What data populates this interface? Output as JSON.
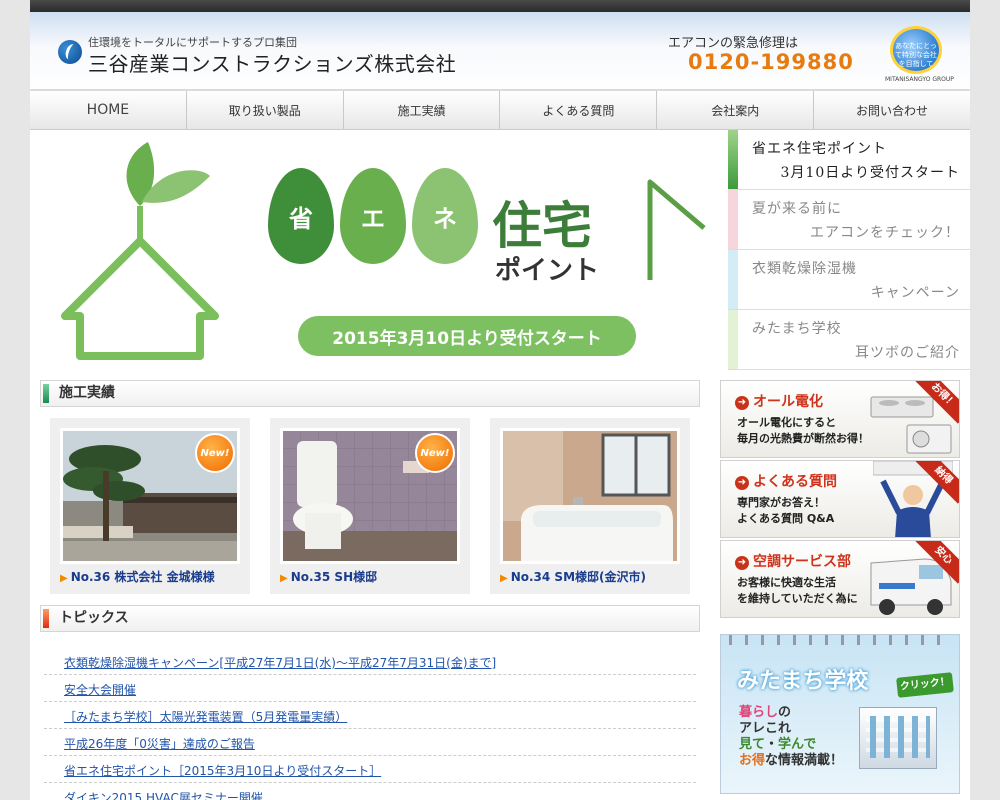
{
  "header": {
    "tagline": "住環境をトータルにサポートするプロ集団",
    "company": "三谷産業コンストラクションズ株式会社",
    "contact_label": "エアコンの緊急修理は",
    "phone": "0120-199880",
    "badge_label": "MITANISANGYO GROUP",
    "badge_text": "あなたにとって特別な会社を目指して"
  },
  "nav": {
    "items": [
      "HOME",
      "取り扱い製品",
      "施工実績",
      "よくある質問",
      "会社案内",
      "お問い合わせ"
    ]
  },
  "hero": {
    "leaves": [
      "省",
      "エ",
      "ネ"
    ],
    "word1": "住宅",
    "word2": "ポイント",
    "pill": "2015年3月10日より受付スタート"
  },
  "slider_tabs": [
    {
      "line1": "省エネ住宅ポイント",
      "line2": "3月10日より受付スタート",
      "color": "#3d9a3d"
    },
    {
      "line1": "夏が来る前に",
      "line2": "エアコンをチェック！",
      "color": "#f6d6dc"
    },
    {
      "line1": "衣類乾燥除湿機",
      "line2": "キャンペーン",
      "color": "#d3ecf6"
    },
    {
      "line1": "みたまち学校",
      "line2": "耳ツボのご紹介",
      "color": "#e3f1d4"
    }
  ],
  "works": {
    "heading": "施工実績",
    "new_label": "New!",
    "items": [
      {
        "caption": "No.36 株式会社 金城様様",
        "is_new": true
      },
      {
        "caption": "No.35 SH様邸",
        "is_new": true
      },
      {
        "caption": "No.34 SM様邸(金沢市)",
        "is_new": false
      }
    ]
  },
  "topics": {
    "heading": "トピックス",
    "items": [
      "衣類乾燥除湿機キャンペーン[平成27年7月1日(水)～平成27年7月31日(金)まで]",
      "安全大会開催",
      "［みたまち学校］太陽光発電装置（5月発電量実績）",
      "平成26年度「0災害」達成のご報告",
      "省エネ住宅ポイント［2015年3月10日より受付スタート］",
      "ダイキン2015 HVAC展セミナー開催"
    ]
  },
  "promos": [
    {
      "title": "オール電化",
      "text1": "オール電化にすると",
      "text2": "毎月の光熱費が断然お得！",
      "ribbon": "お得！"
    },
    {
      "title": "よくある質問",
      "text1": "専門家がお答え！",
      "text2": "よくある質問 Q&A",
      "ribbon": "納得"
    },
    {
      "title": "空調サービス部",
      "text1": "お客様に快適な生活",
      "text2": "を維持していただく為に",
      "ribbon": "安心"
    }
  ],
  "school": {
    "title": "みたまち学校",
    "click": "クリック！",
    "line1_a": "暮らし",
    "line1_b": "の",
    "line2": "アレこれ",
    "line3_a": "見て",
    "line3_b": "・",
    "line3_c": "学んで",
    "line4_a": "お得",
    "line4_b": "な情報満載！"
  },
  "colors": {
    "accent_orange": "#e87b10",
    "link_blue": "#2255aa",
    "leaf_greens": [
      "#3f8f3a",
      "#6aaf4e",
      "#8cc372"
    ]
  }
}
